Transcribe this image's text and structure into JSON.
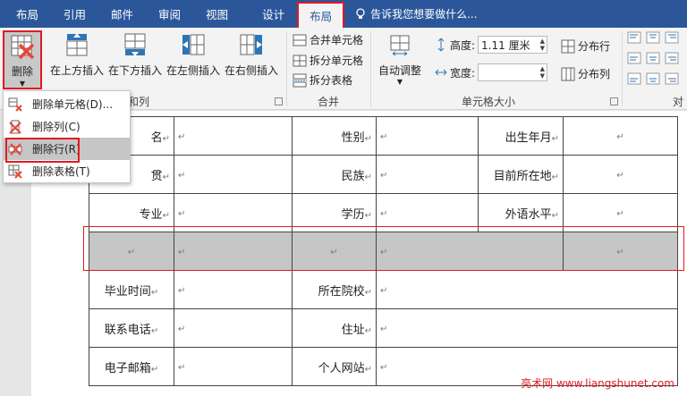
{
  "tabs": [
    {
      "label": "布局"
    },
    {
      "label": "引用"
    },
    {
      "label": "邮件"
    },
    {
      "label": "审阅"
    },
    {
      "label": "视图"
    },
    {
      "label": "设计"
    },
    {
      "label": "布局"
    }
  ],
  "tell_me": "告诉我您想要做什么...",
  "ribbon": {
    "delete_label": "删除",
    "insert_above": "在上方插入",
    "insert_below": "在下方插入",
    "insert_left": "在左侧插入",
    "insert_right": "在右侧插入",
    "group_rows_cols": "和列",
    "merge_cells": "合并单元格",
    "split_cells": "拆分单元格",
    "split_table": "拆分表格",
    "group_merge": "合并",
    "autofit": "自动调整",
    "height_label": "高度:",
    "height_value": "1.11 厘米",
    "width_label": "宽度:",
    "width_value": "",
    "distribute_rows": "分布行",
    "distribute_cols": "分布列",
    "group_cell_size": "单元格大小",
    "group_align_partial": "对"
  },
  "delete_menu": [
    {
      "label": "删除单元格(D)..."
    },
    {
      "label": "删除列(C)"
    },
    {
      "label": "删除行(R)"
    },
    {
      "label": "删除表格(T)"
    }
  ],
  "table": {
    "mark": "↵",
    "rows": [
      [
        "名",
        "",
        "性别",
        "",
        "出生年月",
        ""
      ],
      [
        "贯",
        "",
        "民族",
        "",
        "目前所在地",
        ""
      ],
      [
        "专业",
        "",
        "学历",
        "",
        "外语水平",
        ""
      ],
      [
        "",
        "",
        "",
        "",
        "",
        ""
      ],
      [
        "毕业时间",
        "",
        "所在院校",
        "",
        "",
        ""
      ],
      [
        "联系电话",
        "",
        "住址",
        "",
        "",
        ""
      ],
      [
        "电子邮箱",
        "",
        "个人网站",
        "",
        "",
        ""
      ]
    ]
  },
  "watermark": "亮术网 www.liangshunet.com",
  "colors": {
    "accent": "#2b579a",
    "highlight": "#e01b24",
    "selection": "#c6c6c6"
  }
}
